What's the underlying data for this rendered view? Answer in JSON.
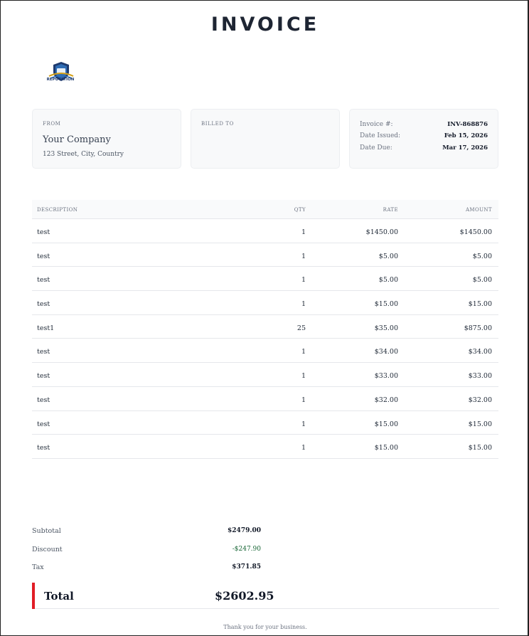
{
  "title": "INVOICE",
  "logo": {
    "text": "REPUTATION",
    "icon": "shield-logo-icon"
  },
  "from": {
    "label": "FROM",
    "company": "Your Company",
    "address": "123 Street, City, Country"
  },
  "billed_to": {
    "label": "BILLED TO"
  },
  "meta": [
    {
      "label": "Invoice #:",
      "value": "INV-868876"
    },
    {
      "label": "Date Issued:",
      "value": "Feb 15, 2026"
    },
    {
      "label": "Date Due:",
      "value": "Mar 17, 2026"
    }
  ],
  "table": {
    "headers": {
      "description": "DESCRIPTION",
      "qty": "QTY",
      "rate": "RATE",
      "amount": "AMOUNT"
    },
    "rows": [
      {
        "description": "test",
        "qty": "1",
        "rate": "$1450.00",
        "amount": "$1450.00"
      },
      {
        "description": "test",
        "qty": "1",
        "rate": "$5.00",
        "amount": "$5.00"
      },
      {
        "description": "test",
        "qty": "1",
        "rate": "$5.00",
        "amount": "$5.00"
      },
      {
        "description": "test",
        "qty": "1",
        "rate": "$15.00",
        "amount": "$15.00"
      },
      {
        "description": "test1",
        "qty": "25",
        "rate": "$35.00",
        "amount": "$875.00"
      },
      {
        "description": "test",
        "qty": "1",
        "rate": "$34.00",
        "amount": "$34.00"
      },
      {
        "description": "test",
        "qty": "1",
        "rate": "$33.00",
        "amount": "$33.00"
      },
      {
        "description": "test",
        "qty": "1",
        "rate": "$32.00",
        "amount": "$32.00"
      },
      {
        "description": "test",
        "qty": "1",
        "rate": "$15.00",
        "amount": "$15.00"
      },
      {
        "description": "test",
        "qty": "1",
        "rate": "$15.00",
        "amount": "$15.00"
      }
    ]
  },
  "totals": {
    "subtotal": {
      "label": "Subtotal",
      "value": "$2479.00"
    },
    "discount": {
      "label": "Discount",
      "value": "-$247.90"
    },
    "tax": {
      "label": "Tax",
      "value": "$371.85"
    },
    "total": {
      "label": "Total",
      "value": "$2602.95"
    }
  },
  "footer": "Thank you for your business.",
  "colors": {
    "accent": "#e11d26",
    "discount": "#166534",
    "title": "#1e2533"
  }
}
